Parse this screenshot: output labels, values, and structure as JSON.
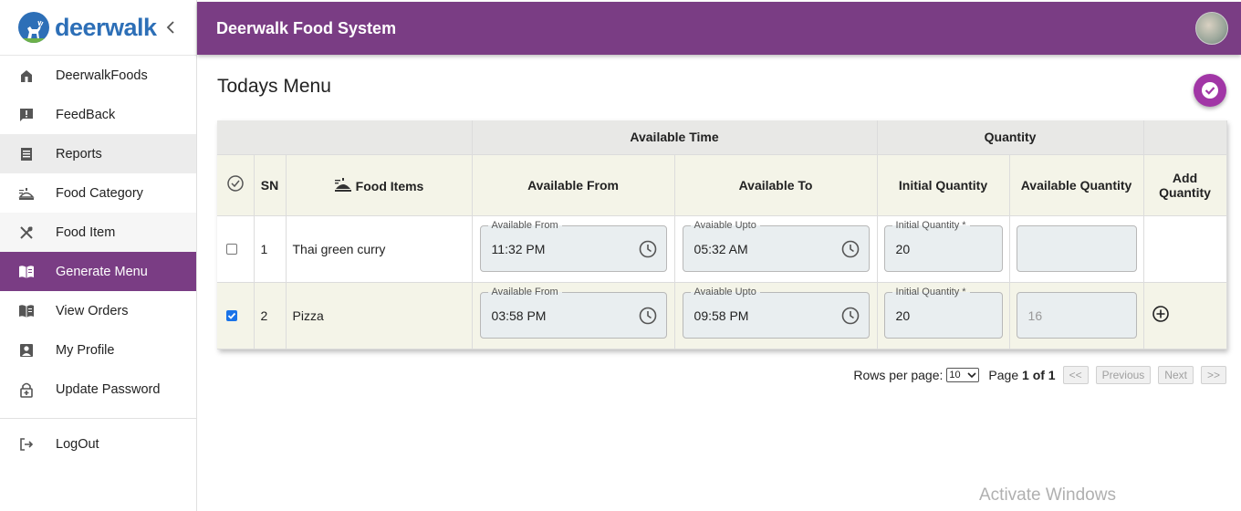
{
  "brand": {
    "name": "deerwalk"
  },
  "sidebar": {
    "items": [
      {
        "label": "DeerwalkFoods",
        "icon": "home-icon"
      },
      {
        "label": "FeedBack",
        "icon": "feedback-icon"
      },
      {
        "label": "Reports",
        "icon": "receipt-icon"
      },
      {
        "label": "Food Category",
        "icon": "food-category-icon"
      },
      {
        "label": "Food Item",
        "icon": "cutlery-icon"
      },
      {
        "label": "Generate Menu",
        "icon": "menu-book-icon"
      },
      {
        "label": "View Orders",
        "icon": "menu-book-icon"
      },
      {
        "label": "My Profile",
        "icon": "profile-icon"
      },
      {
        "label": "Update Password",
        "icon": "lock-icon"
      }
    ],
    "logout": "LogOut",
    "active_index": 5
  },
  "header": {
    "title": "Deerwalk Food System"
  },
  "page": {
    "title": "Todays Menu"
  },
  "table": {
    "group_headers": {
      "available_time": "Available Time",
      "quantity": "Quantity"
    },
    "columns": {
      "sn": "SN",
      "food_items": "Food Items",
      "available_from": "Available From",
      "available_to": "Available To",
      "initial_quantity": "Initial Quantity",
      "available_quantity": "Available Quantity",
      "add_quantity": "Add Quantity"
    },
    "field_labels": {
      "from": "Available From",
      "to": "Avaiable Upto",
      "initial": "Initial Quantity *"
    },
    "rows": [
      {
        "checked": false,
        "sn": "1",
        "food": "Thai green curry",
        "from": "11:32 PM",
        "to": "05:32 AM",
        "initial": "20",
        "available": ""
      },
      {
        "checked": true,
        "sn": "2",
        "food": "Pizza",
        "from": "03:58 PM",
        "to": "09:58 PM",
        "initial": "20",
        "available": "16"
      }
    ]
  },
  "pagination": {
    "rows_per_page_label": "Rows per page:",
    "rows_per_page": "10",
    "page_label": "Page",
    "page": "1",
    "of_label": "of",
    "total": "1",
    "first": "<<",
    "previous": "Previous",
    "next": "Next",
    "last": ">>"
  },
  "watermark": "Activate Windows",
  "colors": {
    "primary": "#7a3d84",
    "fab": "#a136a6",
    "brand": "#2d6fb7"
  }
}
